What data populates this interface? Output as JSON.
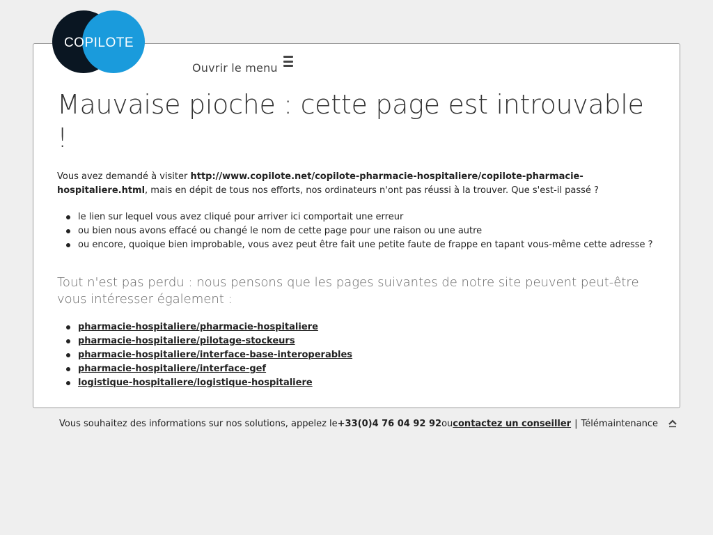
{
  "logo": {
    "text": "COPILOTE",
    "colors": {
      "dark": "#0a1622",
      "blue": "#1a9bdc"
    }
  },
  "menu": {
    "label": "Ouvrir le menu",
    "icon": "hamburger-icon"
  },
  "error": {
    "title": "Mauvaise pioche : cette page est introuvable !",
    "intro_prefix": "Vous avez demandé à visiter ",
    "url": "http://www.copilote.net/copilote-pharmacie-hospitaliere/copilote-pharmacie-hospitaliere.html",
    "intro_suffix": ", mais en dépit de tous nos efforts, nos ordinateurs n'ont pas réussi à la trouver. Que s'est-il passé ?",
    "reasons": [
      "le lien sur lequel vous avez cliqué pour arriver ici comportait une erreur",
      "ou bien nous avons effacé ou changé le nom de cette page pour une raison ou une autre",
      "ou encore, quoique bien improbable, vous avez peut être fait une petite faute de frappe en tapant vous-même cette adresse ?"
    ]
  },
  "suggestions": {
    "heading": "Tout n'est pas perdu : nous pensons que les pages suivantes de notre site peuvent peut-être vous intéresser également :",
    "links": [
      "pharmacie-hospitaliere/pharmacie-hospitaliere",
      "pharmacie-hospitaliere/pilotage-stockeurs",
      "pharmacie-hospitaliere/interface-base-interoperables",
      "pharmacie-hospitaliere/interface-gef",
      "logistique-hospitaliere/logistique-hospitaliere"
    ]
  },
  "footer": {
    "text": "Vous souhaitez des informations sur nos solutions, appelez le ",
    "phone": "+33(0)4 76 04 92 92",
    "or": " ou ",
    "contact_link": "contactez un conseiller",
    "separator": "|",
    "maintenance": "Télémaintenance",
    "top_icon": "chevron-up-icon"
  }
}
